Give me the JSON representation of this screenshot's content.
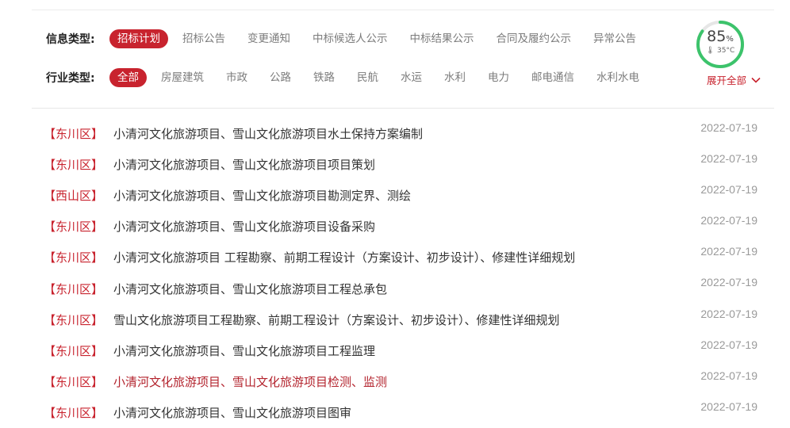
{
  "filters": {
    "info_type": {
      "label": "信息类型:",
      "options": [
        "招标计划",
        "招标公告",
        "变更通知",
        "中标候选人公示",
        "中标结果公示",
        "合同及履约公示",
        "异常公告"
      ],
      "selected": "招标计划"
    },
    "industry_type": {
      "label": "行业类型:",
      "options": [
        "全部",
        "房屋建筑",
        "市政",
        "公路",
        "铁路",
        "民航",
        "水运",
        "水利",
        "电力",
        "邮电通信",
        "水利水电"
      ],
      "selected": "全部"
    },
    "expand_label": "展开全部"
  },
  "gauge": {
    "percent": "85",
    "percent_unit": "%",
    "temperature": "35°C",
    "fraction": 0.85
  },
  "notices": [
    {
      "district": "【东川区】",
      "title": "小清河文化旅游项目、雪山文化旅游项目水土保持方案编制",
      "date": "2022-07-19"
    },
    {
      "district": "【东川区】",
      "title": "小清河文化旅游项目、雪山文化旅游项目项目策划",
      "date": "2022-07-19"
    },
    {
      "district": "【西山区】",
      "title": "小清河文化旅游项目、雪山文化旅游项目勘测定界、测绘",
      "date": "2022-07-19"
    },
    {
      "district": "【东川区】",
      "title": "小清河文化旅游项目、雪山文化旅游项目设备采购",
      "date": "2022-07-19"
    },
    {
      "district": "【东川区】",
      "title": "小清河文化旅游项目 工程勘察、前期工程设计（方案设计、初步设计）、修建性详细规划",
      "date": "2022-07-19"
    },
    {
      "district": "【东川区】",
      "title": "小清河文化旅游项目、雪山文化旅游项目工程总承包",
      "date": "2022-07-19"
    },
    {
      "district": "【东川区】",
      "title": "雪山文化旅游项目工程勘察、前期工程设计（方案设计、初步设计）、修建性详细规划",
      "date": "2022-07-19"
    },
    {
      "district": "【东川区】",
      "title": "小清河文化旅游项目、雪山文化旅游项目工程监理",
      "date": "2022-07-19"
    },
    {
      "district": "【东川区】",
      "title": "小清河文化旅游项目、雪山文化旅游项目检测、监测",
      "date": "2022-07-19",
      "highlight": true
    },
    {
      "district": "【东川区】",
      "title": "小清河文化旅游项目、雪山文化旅游项目图审",
      "date": "2022-07-19"
    }
  ],
  "colors": {
    "accent": "#c8232e",
    "gauge_green": "#3cc36b",
    "muted_text": "#7c7c7c"
  }
}
